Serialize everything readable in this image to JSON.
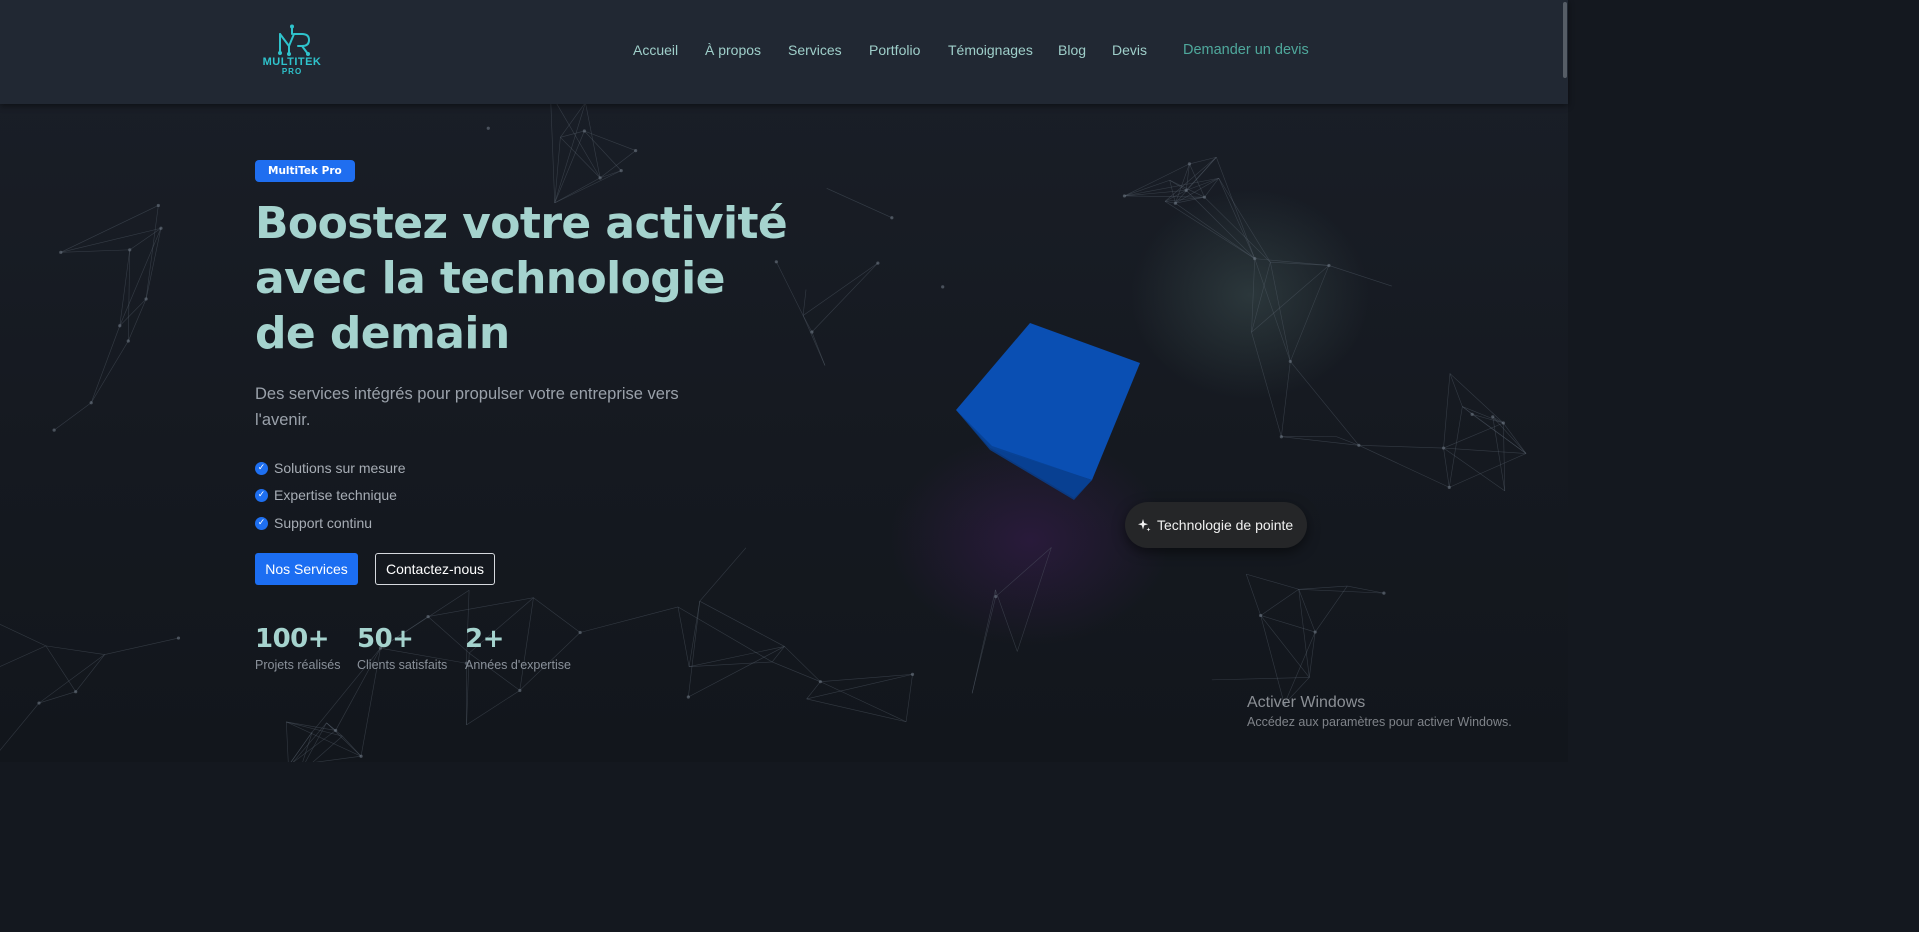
{
  "brand": {
    "logo_line1": "MULTITEK",
    "logo_line2": "PRO",
    "color": "#2fc3cc"
  },
  "nav": {
    "items": [
      {
        "label": "Accueil"
      },
      {
        "label": "À propos"
      },
      {
        "label": "Services"
      },
      {
        "label": "Portfolio"
      },
      {
        "label": "Témoignages"
      },
      {
        "label": "Blog"
      },
      {
        "label": "Devis"
      }
    ],
    "cta": "Demander un devis"
  },
  "hero": {
    "badge": "MultiTek Pro",
    "headline_lines": [
      "Boostez votre activité",
      "avec la technologie",
      "de demain"
    ],
    "subtitle": "Des services intégrés pour propulser votre entreprise vers l'avenir.",
    "features": [
      {
        "label": "Solutions sur mesure",
        "icon": "check-circle-icon"
      },
      {
        "label": "Expertise technique",
        "icon": "check-circle-icon"
      },
      {
        "label": "Support continu",
        "icon": "check-circle-icon"
      }
    ],
    "buttons": {
      "primary": "Nos Services",
      "secondary": "Contactez-nous"
    },
    "stats": [
      {
        "value": "100+",
        "label": "Projets réalisés"
      },
      {
        "value": "50+",
        "label": "Clients satisfaits"
      },
      {
        "value": "2+",
        "label": "Années d'expertise"
      }
    ],
    "floating_badge": {
      "label": "Technologie de pointe",
      "icon": "sparkle-icon"
    }
  },
  "watermark": {
    "title": "Activer Windows",
    "subtitle": "Accédez aux paramètres pour activer Windows."
  },
  "colors": {
    "accent": "#1f6ef0",
    "headline": "#a5d3ce",
    "background": "#14181f",
    "header": "#212833",
    "cube": "#0a4fb0"
  }
}
